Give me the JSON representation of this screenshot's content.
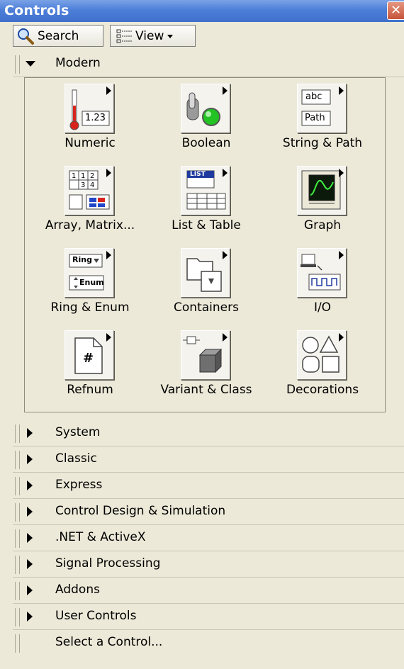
{
  "window": {
    "title": "Controls",
    "close_glyph": "✕"
  },
  "toolbar": {
    "search_label": "Search",
    "view_label": "View"
  },
  "modern": {
    "label": "Modern",
    "items": [
      {
        "label": "Numeric",
        "icon": "numeric-icon"
      },
      {
        "label": "Boolean",
        "icon": "boolean-icon"
      },
      {
        "label": "String & Path",
        "icon": "string-path-icon"
      },
      {
        "label": "Array, Matrix...",
        "icon": "array-matrix-icon"
      },
      {
        "label": "List & Table",
        "icon": "list-table-icon"
      },
      {
        "label": "Graph",
        "icon": "graph-icon"
      },
      {
        "label": "Ring & Enum",
        "icon": "ring-enum-icon"
      },
      {
        "label": "Containers",
        "icon": "containers-icon"
      },
      {
        "label": "I/O",
        "icon": "io-icon"
      },
      {
        "label": "Refnum",
        "icon": "refnum-icon"
      },
      {
        "label": "Variant & Class",
        "icon": "variant-class-icon"
      },
      {
        "label": "Decorations",
        "icon": "decorations-icon"
      }
    ],
    "icon_text": {
      "numeric": "1.23",
      "abc": "abc",
      "path": "Path",
      "list": "LIST",
      "ring": "Ring",
      "enum": "Enum",
      "refnum": "#"
    }
  },
  "categories": [
    {
      "label": "System"
    },
    {
      "label": "Classic"
    },
    {
      "label": "Express"
    },
    {
      "label": "Control Design & Simulation"
    },
    {
      "label": ".NET & ActiveX"
    },
    {
      "label": "Signal Processing"
    },
    {
      "label": "Addons"
    },
    {
      "label": "User Controls"
    }
  ],
  "footer": {
    "select_label": "Select a Control..."
  },
  "colors": {
    "title_bar": "#4d7fd9",
    "close_button": "#c6533a",
    "boolean_led": "#22c322"
  }
}
